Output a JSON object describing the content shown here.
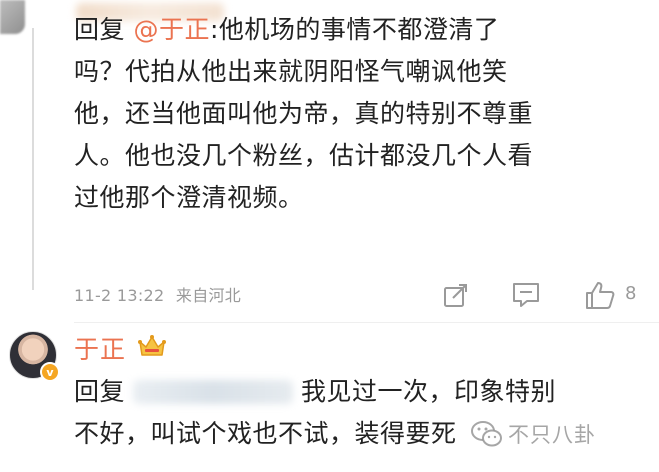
{
  "first_reply": {
    "prefix": "回复",
    "mention": "@于正",
    "lines": [
      ":他机场的事情不都澄清了",
      "吗？代拍从他出来就阴阳怪气嘲讽他笑",
      "他，还当他面叫他为帝，真的特别不尊重",
      "人。他也没几个粉丝，估计都没几个人看",
      "过他那个澄清视频。"
    ],
    "meta": {
      "time": "11-2 13:22",
      "source": "来自河北"
    },
    "actions": {
      "share_icon": "share-icon",
      "comment_icon": "comment-icon",
      "like_icon": "thumbs-up-icon",
      "like_count": "8"
    }
  },
  "second_comment": {
    "author": "于正",
    "author_color": "#eb7350",
    "badge_icon": "crown-icon",
    "reply_prefix": "回复",
    "line1_after_blur": "我见过一次，印象特别",
    "line2": "不好，叫试个戏也不试，装得要死"
  },
  "watermark": {
    "text": "不只八卦"
  },
  "colors": {
    "mention": "#eb7350",
    "meta": "#9a9a9a",
    "text": "#222222"
  }
}
